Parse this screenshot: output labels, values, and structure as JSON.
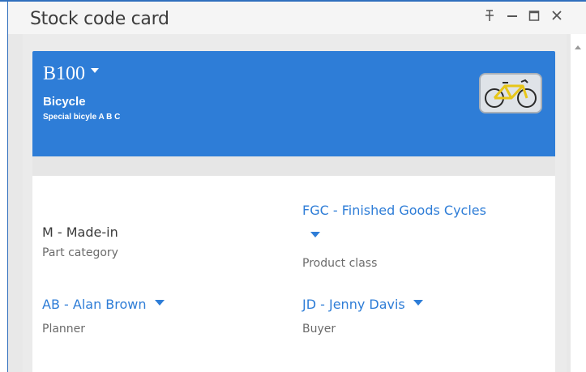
{
  "window": {
    "title": "Stock code card",
    "controls": {
      "pin": "ꟸ",
      "minimize": "–",
      "maximize": "☐",
      "close": "✕"
    }
  },
  "header": {
    "code": "B100",
    "description": "Bicycle",
    "subdescription": "Special bicyle A B C",
    "image_icon": "bicycle-image",
    "background_color": "#2e7dd7"
  },
  "fields": {
    "part_category": {
      "value": "M - Made-in",
      "label": "Part category"
    },
    "product_class": {
      "value": "FGC - Finished Goods Cycles",
      "label": "Product class"
    },
    "planner": {
      "value": "AB - Alan Brown",
      "label": "Planner"
    },
    "buyer": {
      "value": "JD - Jenny Davis",
      "label": "Buyer"
    }
  },
  "colors": {
    "accent": "#2e7dd7",
    "frame": "#2f6fbd",
    "label_gray": "#6b6b6b"
  }
}
